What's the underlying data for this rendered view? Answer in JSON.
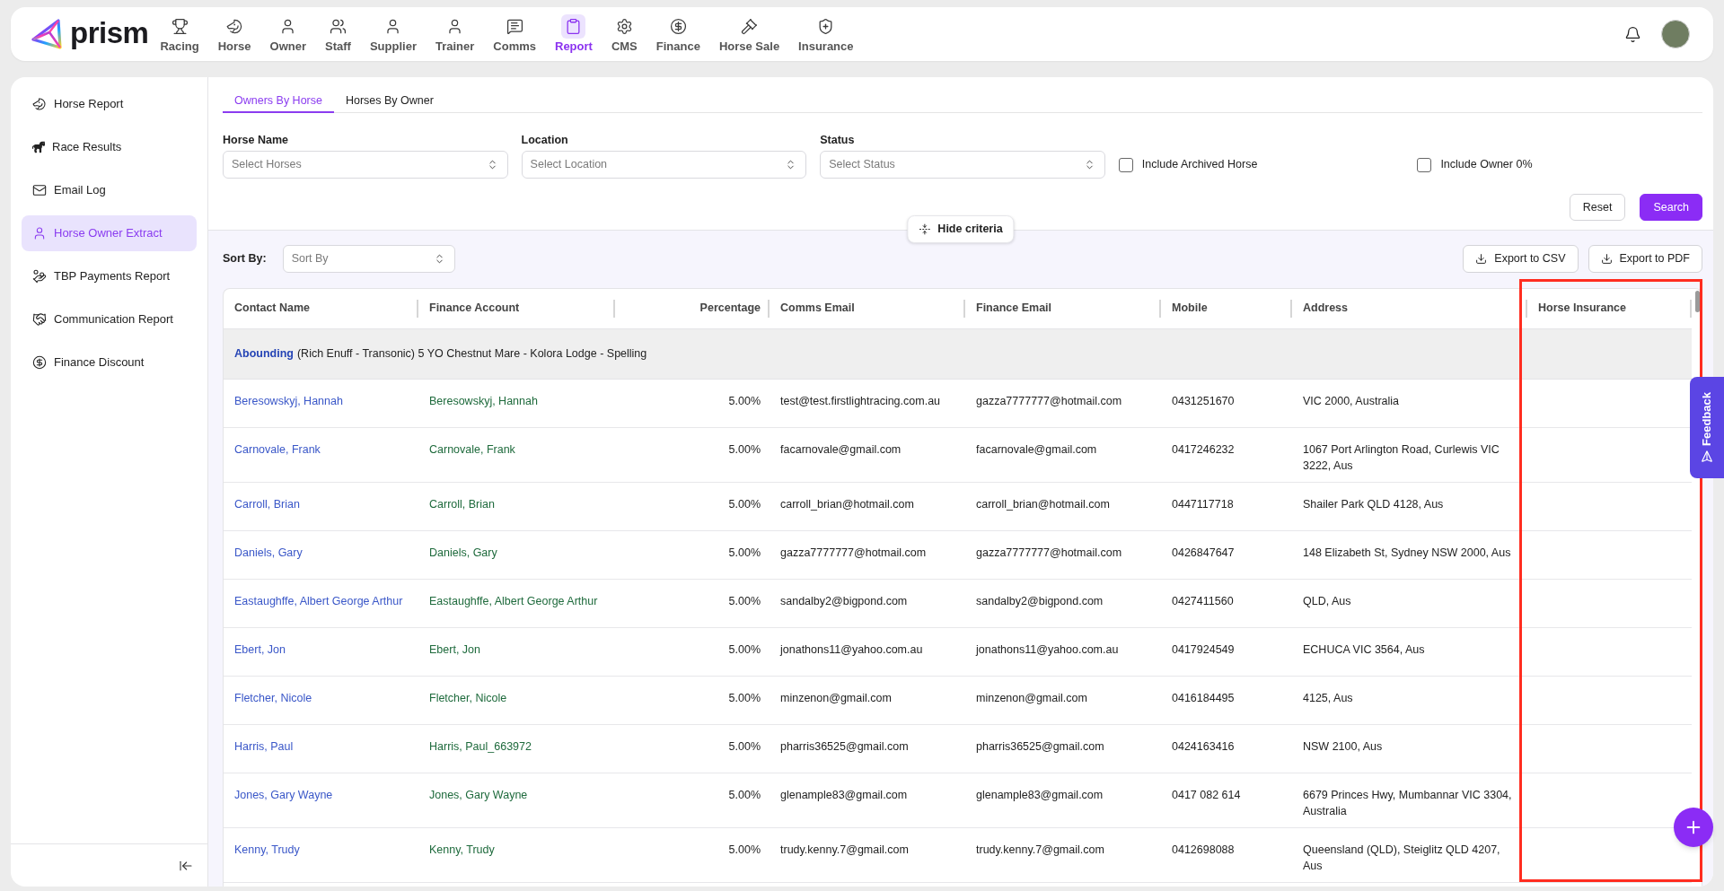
{
  "top_nav": {
    "brand": "prism",
    "items": [
      {
        "label": "Racing",
        "selected": false
      },
      {
        "label": "Horse",
        "selected": false
      },
      {
        "label": "Owner",
        "selected": false
      },
      {
        "label": "Staff",
        "selected": false
      },
      {
        "label": "Supplier",
        "selected": false
      },
      {
        "label": "Trainer",
        "selected": false
      },
      {
        "label": "Comms",
        "selected": false
      },
      {
        "label": "Report",
        "selected": true
      },
      {
        "label": "CMS",
        "selected": false
      },
      {
        "label": "Finance",
        "selected": false
      },
      {
        "label": "Horse Sale",
        "selected": false
      },
      {
        "label": "Insurance",
        "selected": false
      }
    ]
  },
  "sidebar": {
    "items": [
      {
        "label": "Horse Report",
        "selected": false
      },
      {
        "label": "Race Results",
        "selected": false
      },
      {
        "label": "Email Log",
        "selected": false
      },
      {
        "label": "Horse Owner Extract",
        "selected": true
      },
      {
        "label": "TBP Payments Report",
        "selected": false
      },
      {
        "label": "Communication Report",
        "selected": false
      },
      {
        "label": "Finance Discount",
        "selected": false
      }
    ]
  },
  "tabs": [
    {
      "label": "Owners By Horse",
      "selected": true
    },
    {
      "label": "Horses By Owner",
      "selected": false
    }
  ],
  "filters": {
    "fields": [
      {
        "label": "Horse Name",
        "placeholder": "Select Horses"
      },
      {
        "label": "Location",
        "placeholder": "Select Location"
      },
      {
        "label": "Status",
        "placeholder": "Select Status"
      }
    ],
    "checkboxes": [
      {
        "label": "Include Archived Horse",
        "checked": false
      },
      {
        "label": "Include Owner 0%",
        "checked": false
      }
    ],
    "buttons": [
      {
        "label": "Reset",
        "kind": "secondary"
      },
      {
        "label": "Search",
        "kind": "primary"
      }
    ]
  },
  "criteria_toggle": "Hide criteria",
  "sort": {
    "label": "Sort By:",
    "placeholder": "Sort By"
  },
  "export_buttons": [
    "Export to CSV",
    "Export to PDF"
  ],
  "table": {
    "columns": [
      {
        "label": "Contact Name",
        "kind": "text",
        "highlighted": false
      },
      {
        "label": "Finance Account",
        "kind": "text",
        "highlighted": false
      },
      {
        "label": "Percentage",
        "kind": "number",
        "highlighted": false
      },
      {
        "label": "Comms Email",
        "kind": "text",
        "highlighted": false
      },
      {
        "label": "Finance Email",
        "kind": "text",
        "highlighted": false
      },
      {
        "label": "Mobile",
        "kind": "text",
        "highlighted": false
      },
      {
        "label": "Address",
        "kind": "text",
        "highlighted": false
      },
      {
        "label": "Horse Insurance",
        "kind": "text",
        "highlighted": true
      }
    ],
    "group": {
      "horse": "Abounding",
      "description": "(Rich Enuff - Transonic) 5 YO Chestnut Mare - Kolora Lodge - Spelling"
    },
    "rows": [
      {
        "contact": "Beresowskyj, Hannah",
        "finance_account": "Beresowskyj, Hannah",
        "percentage": "5.00%",
        "comms_email": "test@test.firstlightracing.com.au",
        "finance_email": "gazza7777777@hotmail.com",
        "mobile": "0431251670",
        "address": "VIC 2000, Australia"
      },
      {
        "contact": "Carnovale, Frank",
        "finance_account": "Carnovale, Frank",
        "percentage": "5.00%",
        "comms_email": "facarnovale@gmail.com",
        "finance_email": "facarnovale@gmail.com",
        "mobile": "0417246232",
        "address": "1067 Port Arlington Road, Curlewis VIC 3222, Aus"
      },
      {
        "contact": "Carroll, Brian",
        "finance_account": "Carroll, Brian",
        "percentage": "5.00%",
        "comms_email": "carroll_brian@hotmail.com",
        "finance_email": "carroll_brian@hotmail.com",
        "mobile": "0447117718",
        "address": "Shailer Park QLD 4128, Aus"
      },
      {
        "contact": "Daniels, Gary",
        "finance_account": "Daniels, Gary",
        "percentage": "5.00%",
        "comms_email": "gazza7777777@hotmail.com",
        "finance_email": "gazza7777777@hotmail.com",
        "mobile": "0426847647",
        "address": "148 Elizabeth St, Sydney NSW 2000, Aus"
      },
      {
        "contact": "Eastaughffe, Albert George Arthur",
        "finance_account": "Eastaughffe, Albert George Arthur",
        "percentage": "5.00%",
        "comms_email": "sandalby2@bigpond.com",
        "finance_email": "sandalby2@bigpond.com",
        "mobile": "0427411560",
        "address": "QLD, Aus"
      },
      {
        "contact": "Ebert, Jon",
        "finance_account": "Ebert, Jon",
        "percentage": "5.00%",
        "comms_email": "jonathons11@yahoo.com.au",
        "finance_email": "jonathons11@yahoo.com.au",
        "mobile": "0417924549",
        "address": "ECHUCA VIC 3564, Aus"
      },
      {
        "contact": "Fletcher, Nicole",
        "finance_account": "Fletcher, Nicole",
        "percentage": "5.00%",
        "comms_email": "minzenon@gmail.com",
        "finance_email": "minzenon@gmail.com",
        "mobile": "0416184495",
        "address": "4125, Aus"
      },
      {
        "contact": "Harris, Paul",
        "finance_account": "Harris, Paul_663972",
        "percentage": "5.00%",
        "comms_email": "pharris36525@gmail.com",
        "finance_email": "pharris36525@gmail.com",
        "mobile": "0424163416",
        "address": "NSW 2100, Aus"
      },
      {
        "contact": "Jones, Gary Wayne",
        "finance_account": "Jones, Gary Wayne",
        "percentage": "5.00%",
        "comms_email": "glenample83@gmail.com",
        "finance_email": "glenample83@gmail.com",
        "mobile": "0417 082 614",
        "address": "6679 Princes Hwy, Mumbannar VIC 3304, Australia"
      },
      {
        "contact": "Kenny, Trudy",
        "finance_account": "Kenny, Trudy",
        "percentage": "5.00%",
        "comms_email": "trudy.kenny.7@gmail.com",
        "finance_email": "trudy.kenny.7@gmail.com",
        "mobile": "0412698088",
        "address": "Queensland (QLD), Steiglitz QLD 4207, Aus"
      }
    ]
  },
  "feedback_tab": "Feedback"
}
